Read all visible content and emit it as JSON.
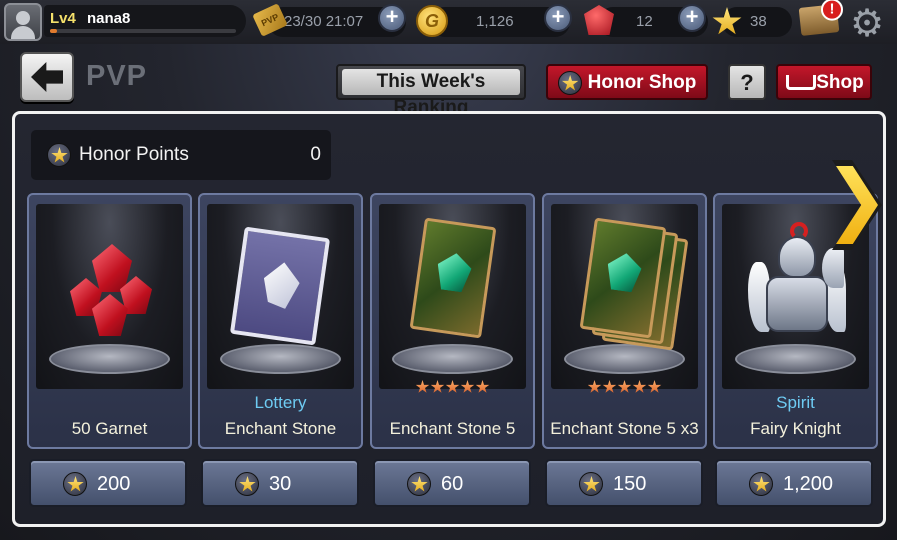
{
  "player": {
    "level": "Lv4",
    "name": "nana8",
    "xp_fraction": 0.04
  },
  "resources": {
    "pvp_tickets": "23/30 21:07",
    "gold": "1,126",
    "garnet": "12",
    "stars": "38",
    "pvp_ticket_label": "PVP",
    "gold_icon_letter": "G",
    "mail_alert": "!"
  },
  "header": {
    "title": "PVP",
    "ranking_label": "This Week's Ranking",
    "honor_shop_label": "Honor Shop",
    "help_label": "?",
    "shop_label": "Shop"
  },
  "honor": {
    "label": "Honor Points",
    "value": "0"
  },
  "items": [
    {
      "subtitle": "",
      "name": "50 Garnet",
      "price": "200",
      "stars": 0,
      "icon": "garnet-cluster-icon"
    },
    {
      "subtitle": "Lottery",
      "name": "Enchant Stone",
      "price": "30",
      "stars": 0,
      "icon": "lottery-scroll-icon"
    },
    {
      "subtitle": "",
      "name": "Enchant Stone 5",
      "price": "60",
      "stars": 5,
      "icon": "enchant-card-icon"
    },
    {
      "subtitle": "",
      "name": "Enchant Stone 5 x3",
      "price": "150",
      "stars": 5,
      "icon": "enchant-card-stack-icon"
    },
    {
      "subtitle": "Spirit",
      "name": "Fairy Knight",
      "price": "1,200",
      "stars": 0,
      "icon": "fairy-knight-icon"
    }
  ],
  "colors": {
    "panel_border": "#f2f2f2",
    "subtitle": "#6ecbf3",
    "item_name": "#f4f1dc",
    "honor_button": "#c3172a",
    "next_arrow": "#f0b011"
  }
}
